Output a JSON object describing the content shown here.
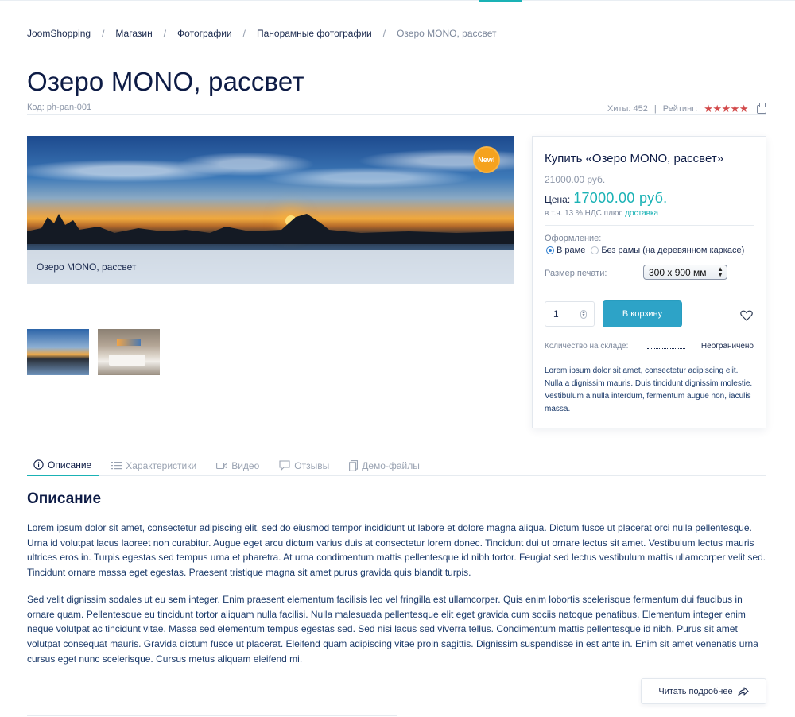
{
  "breadcrumb": {
    "items": [
      "JoomShopping",
      "Магазин",
      "Фотографии",
      "Панорамные фотографии"
    ],
    "current": "Озеро MONO, рассвет",
    "separator": "/"
  },
  "product": {
    "title": "Озеро MONO, рассвет",
    "code": "Код: ph-pan-001",
    "hits": "Хиты: 452",
    "rating_label": "Рейтинг:",
    "rating_stars": "★★★★★",
    "rating_value": 5,
    "meta_divider": "|"
  },
  "gallery": {
    "caption": "Озеро MONO, рассвет",
    "badge": "New!"
  },
  "buy_box": {
    "title": "Купить «Озеро MONO, рассвет»",
    "old_price": "21000.00 руб.",
    "price_label": "Цена:",
    "price": "17000.00 руб.",
    "vat_text": "в т.ч. 13 % НДС плюс",
    "vat_link": "доставка",
    "attr_label": "Оформление:",
    "options": [
      "В раме",
      "Без рамы (на деревянном каркасе)"
    ],
    "selected_option": "В раме",
    "size_label": "Размер печати:",
    "size_value": "300 x 900 мм",
    "qty_value": "1",
    "cart_button": "В корзину",
    "stock_label": "Количество на складе:",
    "stock_value": "Неограничено",
    "short_description": "Lorem ipsum dolor sit amet, consectetur adipiscing elit. Nulla a dignissim mauris. Duis tincidunt dignissim molestie. Vestibulum a nulla interdum, fermentum augue non, iaculis massa."
  },
  "tabs": [
    "Описание",
    "Характеристики",
    "Видео",
    "Отзывы",
    "Демо-файлы"
  ],
  "description": {
    "heading": "Описание",
    "paragraph_1": "Lorem ipsum dolor sit amet, consectetur adipiscing elit, sed do eiusmod tempor incididunt ut labore et dolore magna aliqua. Dictum fusce ut placerat orci nulla pellentesque. Urna id volutpat lacus laoreet non curabitur. Augue eget arcu dictum varius duis at consectetur lorem donec. Tincidunt dui ut ornare lectus sit amet. Vestibulum lectus mauris ultrices eros in. Turpis egestas sed tempus urna et pharetra. At urna condimentum mattis pellentesque id nibh tortor. Feugiat sed lectus vestibulum mattis ullamcorper velit sed. Tincidunt ornare massa eget egestas. Praesent tristique magna sit amet purus gravida quis blandit turpis.",
    "paragraph_2": "Sed velit dignissim sodales ut eu sem integer. Enim praesent elementum facilisis leo vel fringilla est ullamcorper. Quis enim lobortis scelerisque fermentum dui faucibus in ornare quam. Pellentesque eu tincidunt tortor aliquam nulla facilisi. Nulla malesuada pellentesque elit eget gravida cum sociis natoque penatibus. Elementum integer enim neque volutpat ac tincidunt vitae. Massa sed elementum tempus egestas sed. Sed nisi lacus sed viverra tellus. Condimentum mattis pellentesque id nibh. Purus sit amet volutpat consequat mauris. Gravida dictum fusce ut placerat. Eleifend quam adipiscing vitae proin sagittis. Dignissim suspendisse in est ante in. Enim sit amet venenatis urna cursus eget nunc scelerisque. Cursus metus aliquam eleifend mi.",
    "read_more": "Читать подробнее"
  },
  "colors": {
    "accent": "#1ab2b5",
    "button": "#2da3c7",
    "stars": "#d2494a",
    "badge": "#f5a21e"
  }
}
